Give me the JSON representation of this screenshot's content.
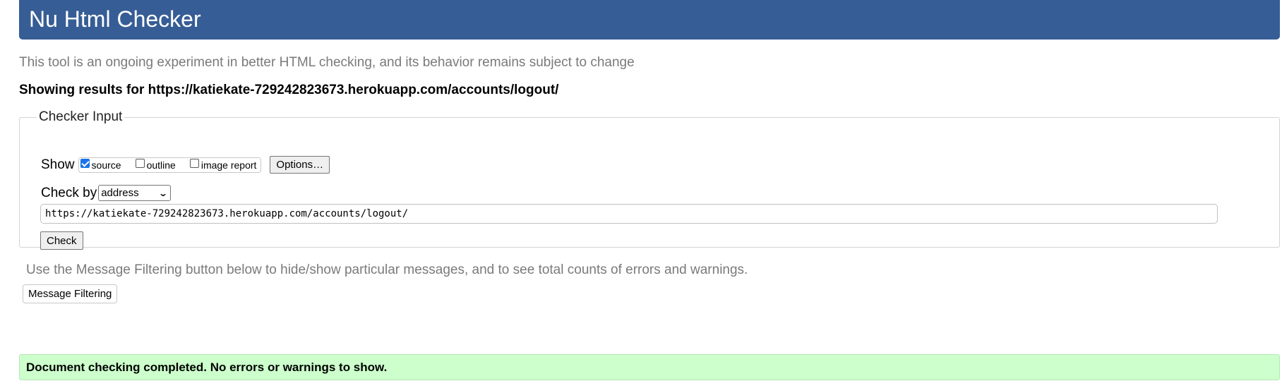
{
  "header": {
    "title": "Nu Html Checker"
  },
  "intro": "This tool is an ongoing experiment in better HTML checking, and its behavior remains subject to change",
  "showing": "Showing results for https://katiekate-729242823673.herokuapp.com/accounts/logout/",
  "checker": {
    "legend": "Checker Input",
    "show_label": "Show",
    "options": [
      {
        "label": "source",
        "checked": true
      },
      {
        "label": "outline",
        "checked": false
      },
      {
        "label": "image report",
        "checked": false
      }
    ],
    "options_button": "Options…",
    "check_by_label": "Check by",
    "check_by_value": "address",
    "url_value": "https://katiekate-729242823673.herokuapp.com/accounts/logout/",
    "check_button": "Check"
  },
  "filter": {
    "note": "Use the Message Filtering button below to hide/show particular messages, and to see total counts of errors and warnings.",
    "button": "Message Filtering"
  },
  "result": {
    "message": "Document checking completed. No errors or warnings to show."
  },
  "colors": {
    "header_bg": "#365d95",
    "success_bg": "#ccffcc",
    "checkbox_checked": "#1a73e8"
  },
  "icons": {
    "select_arrow": "chevron-down-icon"
  }
}
